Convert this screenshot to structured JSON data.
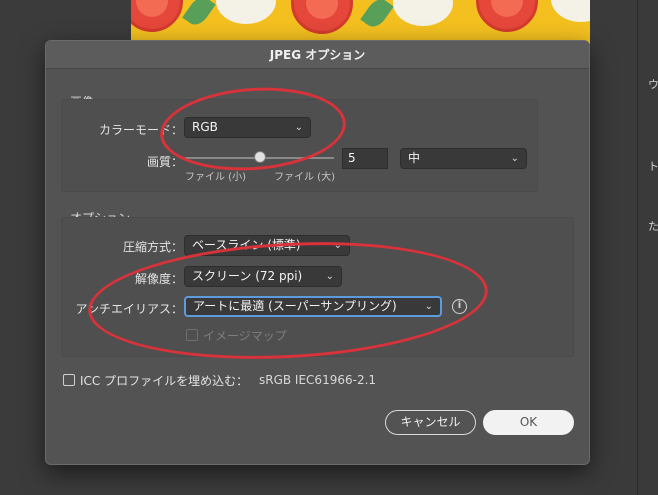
{
  "dialog": {
    "title": "JPEG オプション",
    "image_group": {
      "label": "画像",
      "color_mode_label": "カラーモード：",
      "color_mode_value": "RGB",
      "quality_label": "画質：",
      "quality_value": "5",
      "quality_preset": "中",
      "quality_min_caption": "ファイル (小)",
      "quality_max_caption": "ファイル (大)",
      "quality_level": 0.5
    },
    "options_group": {
      "label": "オプション",
      "compression_label": "圧縮方式：",
      "compression_value": "ベースライン (標準)",
      "resolution_label": "解像度：",
      "resolution_value": "スクリーン (72 ppi)",
      "antialias_label": "アンチエイリアス：",
      "antialias_value": "アートに最適 (スーパーサンプリング)",
      "imagemap_label": "イメージマップ",
      "info_glyph": "i"
    },
    "icc": {
      "label": "ICC プロファイルを埋め込む：",
      "profile": "sRGB IEC61966-2.1"
    },
    "buttons": {
      "cancel": "キャンセル",
      "ok": "OK"
    }
  },
  "right_panel_glyphs": [
    "ウ",
    "ト",
    "た"
  ],
  "colors": {
    "annotation": "#d8323b",
    "focus": "#5d9bdf",
    "dialog_bg": "#535353"
  }
}
